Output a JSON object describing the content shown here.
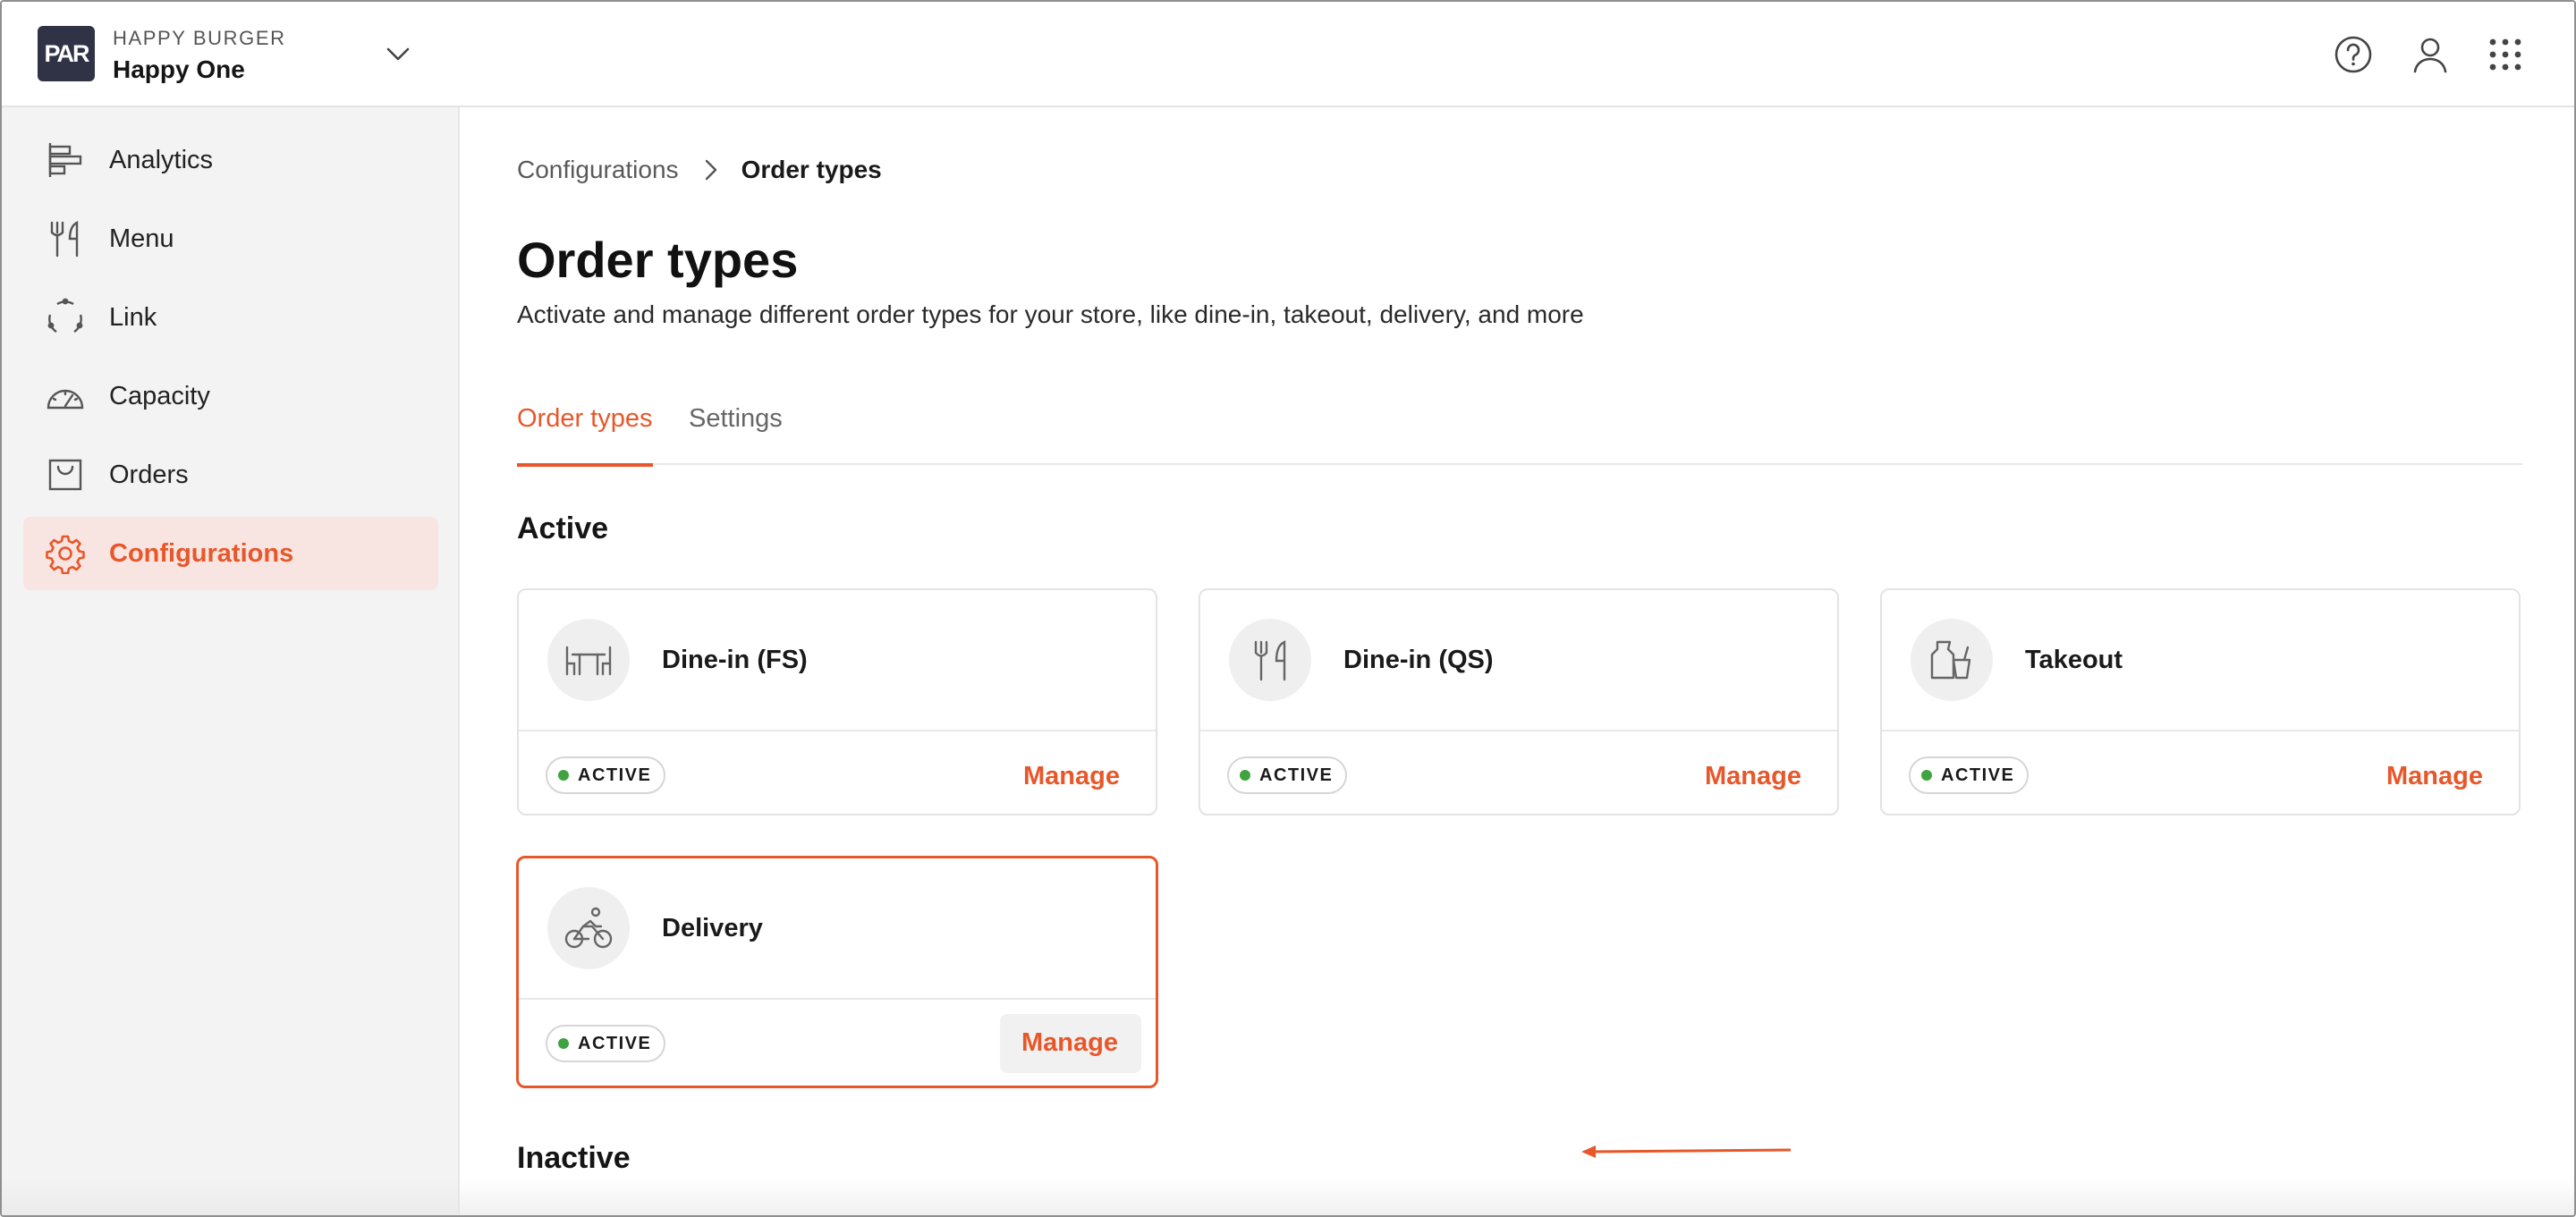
{
  "header": {
    "brand_sub": "HAPPY BURGER",
    "store_name": "Happy One",
    "logo_text": "PAR",
    "icons": [
      "help-icon",
      "user-icon",
      "apps-grid-icon"
    ]
  },
  "sidebar": {
    "items": [
      {
        "label": "Analytics",
        "icon": "analytics-icon"
      },
      {
        "label": "Menu",
        "icon": "fork-knife-icon"
      },
      {
        "label": "Link",
        "icon": "link-icon"
      },
      {
        "label": "Capacity",
        "icon": "gauge-icon"
      },
      {
        "label": "Orders",
        "icon": "orders-bag-icon"
      },
      {
        "label": "Configurations",
        "icon": "gear-icon",
        "active": true
      }
    ]
  },
  "breadcrumb": {
    "parent": "Configurations",
    "current": "Order types"
  },
  "page": {
    "title": "Order types",
    "description": "Activate and manage different order types for your store, like dine-in, takeout, delivery, and more"
  },
  "tabs": [
    {
      "label": "Order types",
      "active": true
    },
    {
      "label": "Settings",
      "active": false
    }
  ],
  "sections": {
    "active_title": "Active",
    "inactive_title": "Inactive"
  },
  "cards": [
    {
      "name": "Dine-in (FS)",
      "status": "ACTIVE",
      "action": "Manage",
      "icon": "table-icon"
    },
    {
      "name": "Dine-in (QS)",
      "status": "ACTIVE",
      "action": "Manage",
      "icon": "fork-knife-icon"
    },
    {
      "name": "Takeout",
      "status": "ACTIVE",
      "action": "Manage",
      "icon": "takeout-bag-icon"
    },
    {
      "name": "Delivery",
      "status": "ACTIVE",
      "action": "Manage",
      "icon": "bicycle-icon",
      "highlighted": true
    }
  ],
  "colors": {
    "accent": "#e8572a",
    "active_dot": "#3fa33f",
    "logo_bg": "#2f3345",
    "sidebar_bg": "#f3f3f3",
    "active_nav_bg": "#f8e5e1"
  }
}
